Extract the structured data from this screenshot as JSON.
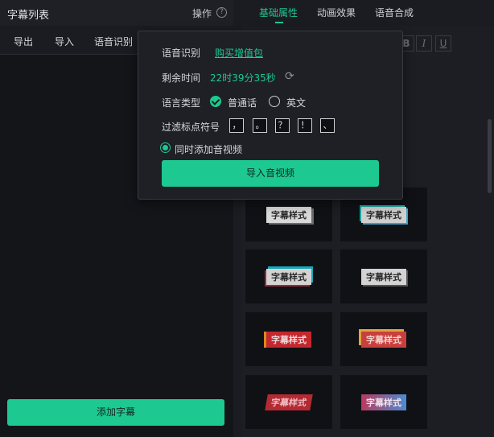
{
  "left_panel": {
    "title": "字幕列表",
    "op_label": "操作",
    "help_icon": "?",
    "toolbar": [
      "导出",
      "导入",
      "语音识别"
    ],
    "add_button": "添加字幕"
  },
  "right_panel": {
    "tabs": [
      "基础属性",
      "动画效果",
      "语音合成"
    ],
    "active_tab": 0,
    "format_buttons": [
      "B",
      "I",
      "U"
    ],
    "style_cards": [
      {
        "text": "字幕样式",
        "variant": "gray"
      },
      {
        "text": "字幕样式",
        "variant": "gray2"
      },
      {
        "text": "字幕样式",
        "variant": "gray3"
      },
      {
        "text": "字幕样式",
        "variant": "gray4"
      },
      {
        "text": "字幕样式",
        "variant": "red"
      },
      {
        "text": "字幕样式",
        "variant": "red2"
      },
      {
        "text": "字幕样式",
        "variant": "red3"
      },
      {
        "text": "字幕样式",
        "variant": "mix"
      }
    ]
  },
  "popup": {
    "speech_label": "语音识别",
    "buy_link": "购买增值包",
    "remaining_label": "剩余时间",
    "remaining_value": "22时39分35秒",
    "refresh_icon": "⟳",
    "lang_label": "语言类型",
    "lang_options": [
      "普通话",
      "英文"
    ],
    "lang_selected": 0,
    "filter_label": "过滤标点符号",
    "punctuation": [
      "，",
      "。",
      "？",
      "！",
      "、"
    ],
    "add_av_label": "同时添加音视频",
    "import_button": "导入音视频"
  },
  "colors": {
    "accent": "#1dc991",
    "panel": "#141519",
    "background": "#1b1c21"
  }
}
